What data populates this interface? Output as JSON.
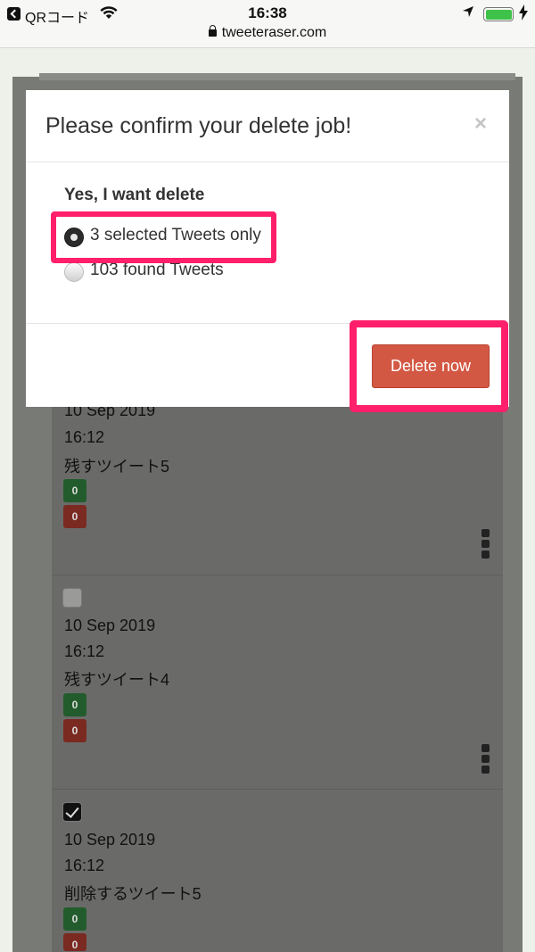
{
  "status_bar": {
    "carrier": "QRコード",
    "time": "16:38",
    "url": "tweeteraser.com"
  },
  "modal": {
    "title": "Please confirm your delete job!",
    "close_label": "×",
    "prompt": "Yes, I want delete",
    "options": [
      {
        "label": "3 selected Tweets only",
        "selected": true
      },
      {
        "label": "103 found Tweets",
        "selected": false
      }
    ],
    "delete_button": "Delete now"
  },
  "tweets": [
    {
      "date": "10 Sep 2019",
      "time": "16:12",
      "text": "残すツイート5",
      "checked": false,
      "likes": "0",
      "retweets": "0"
    },
    {
      "date": "10 Sep 2019",
      "time": "16:12",
      "text": "残すツイート4",
      "checked": false,
      "likes": "0",
      "retweets": "0"
    },
    {
      "date": "10 Sep 2019",
      "time": "16:12",
      "text": "削除するツイート5",
      "checked": true,
      "likes": "0",
      "retweets": "0"
    }
  ],
  "colors": {
    "highlight": "#ff1f6b",
    "delete_button": "#d35844",
    "badge_green": "#235c2c",
    "badge_red": "#7b2a22"
  }
}
